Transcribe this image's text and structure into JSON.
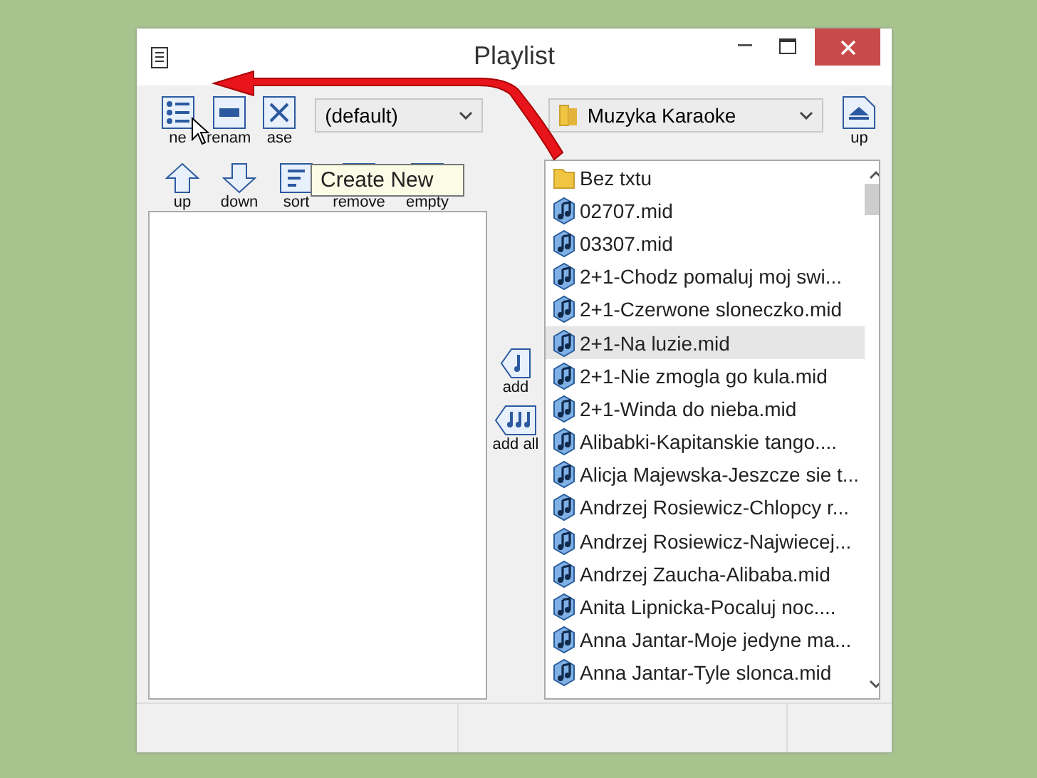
{
  "window": {
    "title": "Playlist"
  },
  "toolbar": {
    "buttons": [
      {
        "label": "ne"
      },
      {
        "label": "renam"
      },
      {
        "label": "ase"
      }
    ],
    "playlist_select": "(default)",
    "folder_select": "Muzyka Karaoke",
    "up_button": "up"
  },
  "tooltip": "Create New",
  "list_tools": [
    "up",
    "down",
    "sort",
    "remove",
    "empty"
  ],
  "transfer_buttons": [
    "add",
    "add all"
  ],
  "files": [
    {
      "name": "Bez txtu",
      "kind": "folder",
      "selected": false
    },
    {
      "name": "02707.mid",
      "kind": "midi",
      "selected": false
    },
    {
      "name": "03307.mid",
      "kind": "midi",
      "selected": false
    },
    {
      "name": "2+1-Chodz pomaluj moj swi...",
      "kind": "midi",
      "selected": false
    },
    {
      "name": "2+1-Czerwone sloneczko.mid",
      "kind": "midi",
      "selected": false
    },
    {
      "name": "2+1-Na luzie.mid",
      "kind": "midi",
      "selected": true
    },
    {
      "name": "2+1-Nie zmogla go kula.mid",
      "kind": "midi",
      "selected": false
    },
    {
      "name": "2+1-Winda do nieba.mid",
      "kind": "midi",
      "selected": false
    },
    {
      "name": "Alibabki-Kapitanskie tango....",
      "kind": "midi",
      "selected": false
    },
    {
      "name": "Alicja Majewska-Jeszcze sie t...",
      "kind": "midi",
      "selected": false
    },
    {
      "name": "Andrzej Rosiewicz-Chlopcy r...",
      "kind": "midi",
      "selected": false
    },
    {
      "name": "Andrzej Rosiewicz-Najwiecej...",
      "kind": "midi",
      "selected": false
    },
    {
      "name": "Andrzej Zaucha-Alibaba.mid",
      "kind": "midi",
      "selected": false
    },
    {
      "name": "Anita Lipnicka-Pocaluj noc....",
      "kind": "midi",
      "selected": false
    },
    {
      "name": "Anna Jantar-Moje jedyne ma...",
      "kind": "midi",
      "selected": false
    },
    {
      "name": "Anna Jantar-Tyle slonca.mid",
      "kind": "midi",
      "selected": false
    }
  ]
}
